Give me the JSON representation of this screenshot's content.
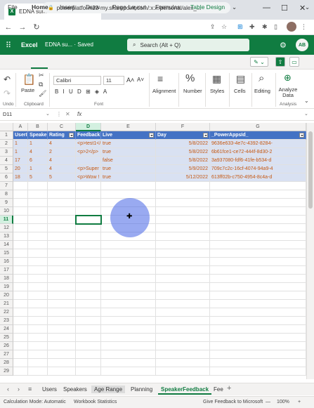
{
  "browser": {
    "tab_title": "EDNA summit.xlsx",
    "favicon": "X",
    "url": "powerplatform23-my.sharepoint.com/:x:/r/personal/alex_...",
    "win_min": "—",
    "win_max": "☐",
    "win_close": "✕"
  },
  "excel": {
    "app_name": "Excel",
    "doc_name": "EDNA su...  ·  Saved",
    "search_placeholder": "Search (Alt + Q)",
    "avatar_initials": "AB"
  },
  "ribbon_tabs": [
    "File",
    "Home",
    "Insert",
    "Draw",
    "Page Layout",
    "Formulas",
    "Table Design"
  ],
  "ribbon": {
    "paste": "Paste",
    "clipboard": "Clipboard",
    "font_name": "Calibri",
    "font_size": "11",
    "font_group": "Font",
    "format_buttons": "B I U D ⊞ ◈ A",
    "alignment": "Alignment",
    "number": "Number",
    "styles": "Styles",
    "cells": "Cells",
    "editing": "Editing",
    "analyze": "Analyze Data",
    "analysis": "Analysis",
    "undo": "Undo"
  },
  "formula_bar": {
    "name_box": "D11",
    "fx": "fx"
  },
  "grid": {
    "columns": [
      "A",
      "B",
      "C",
      "D",
      "E",
      "F",
      "G"
    ],
    "selected_column": "D",
    "selected_row": "11",
    "headers": [
      "UserID",
      "SpeakerID",
      "Rating",
      "Feedback",
      "Live",
      "Day",
      "_PowerAppsId_"
    ],
    "rows": [
      [
        "1",
        "1",
        "4",
        "<p>test1</p>",
        "true",
        "5/8/2022",
        "9636e633-4e7c-4392-8284-"
      ],
      [
        "1",
        "4",
        "2",
        "<p>2</p>",
        "true",
        "5/8/2022",
        "6b61fce1-ce72-444f-8d30-2"
      ],
      [
        "17",
        "6",
        "4",
        "",
        "false",
        "5/8/2022",
        "3a937080-fdf6-41fe-b534-d"
      ],
      [
        "20",
        "1",
        "4",
        "<p>Super wow! 👏</",
        "true",
        "5/9/2022",
        "709c7c2c-16cf-4074-94a9-4"
      ],
      [
        "18",
        "5",
        "5",
        "<p>Wow ! This is great",
        "true",
        "5/12/2022",
        "613ff02b-c750-4954-8c4a-d"
      ]
    ],
    "row_numbers": [
      "1",
      "2",
      "3",
      "4",
      "5",
      "6",
      "7",
      "8",
      "9",
      "10",
      "11",
      "12",
      "13",
      "14",
      "15",
      "16",
      "17",
      "18",
      "19",
      "20",
      "21",
      "22",
      "23",
      "24",
      "25",
      "26",
      "27",
      "28",
      "29"
    ]
  },
  "sheets": [
    "Users",
    "Speakers",
    "Age Range",
    "Planning",
    "SpeakerFeedback",
    "Fee"
  ],
  "active_sheet": "SpeakerFeedback",
  "status": {
    "calc": "Calculation Mode: Automatic",
    "stats": "Workbook Statistics",
    "feedback": "Give Feedback to Microsoft",
    "zoom": "100%"
  }
}
